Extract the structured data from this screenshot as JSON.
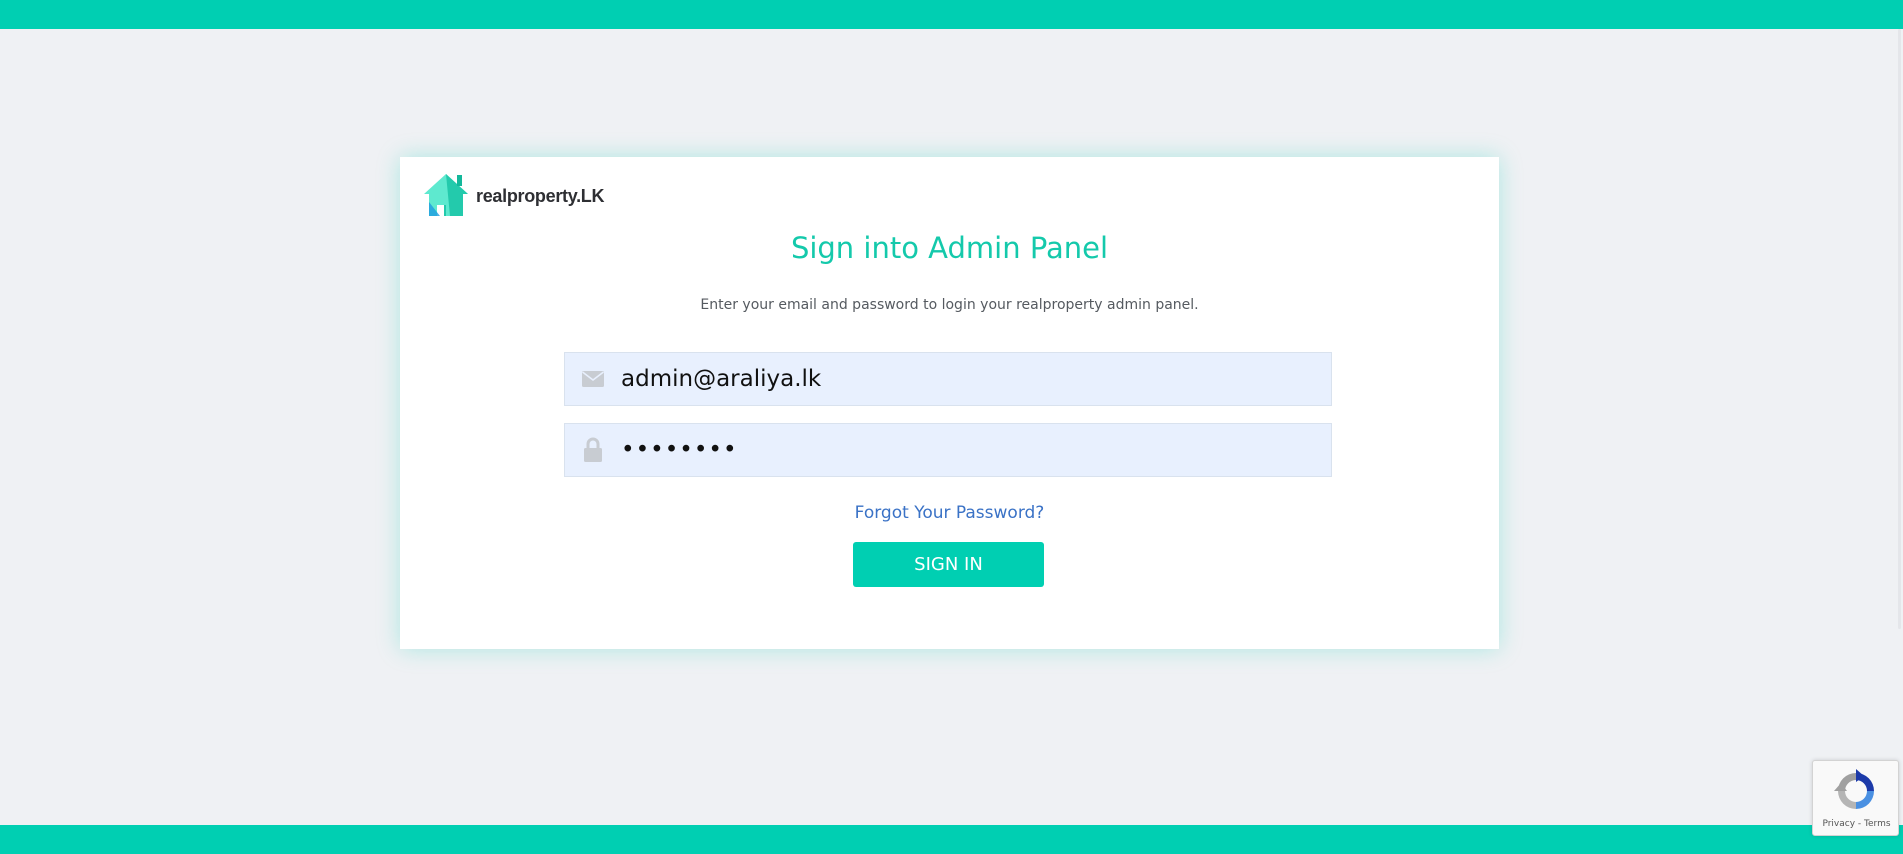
{
  "brand": {
    "name": "realproperty.LK",
    "accent": "#00cfb2",
    "title_color": "#14c9ab"
  },
  "login": {
    "title": "Sign into Admin Panel",
    "subtitle": "Enter your email and password to login your realproperty admin panel.",
    "email": {
      "value": "admin@araliya.lk",
      "icon": "envelope-icon"
    },
    "password": {
      "value": "••••••••",
      "icon": "lock-icon"
    },
    "forgot_label": "Forgot Your Password?",
    "signin_label": "SIGN IN"
  },
  "recaptcha": {
    "privacy_label": "Privacy",
    "separator": " - ",
    "terms_label": "Terms"
  }
}
